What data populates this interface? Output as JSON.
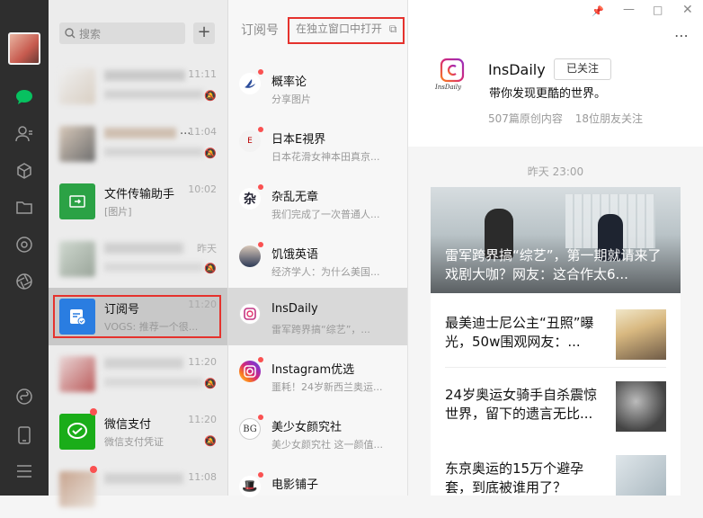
{
  "search": {
    "placeholder": "搜索"
  },
  "chats": [
    {
      "time": "11:11"
    },
    {
      "time": "11:04",
      "extra": "..."
    },
    {
      "name": "文件传输助手",
      "sub": "[图片]",
      "time": "10:02"
    },
    {
      "time": "昨天"
    },
    {
      "name": "订阅号",
      "sub": "VOGS: 推荐一个很...",
      "time": "11:20"
    },
    {
      "time": "11:20"
    },
    {
      "name": "微信支付",
      "sub": "微信支付凭证",
      "time": "11:20"
    },
    {
      "time": "11:08"
    }
  ],
  "subscription": {
    "title": "订阅号",
    "open_label": "在独立窗口中打开",
    "accounts": [
      {
        "name": "概率论",
        "sub": "分享图片"
      },
      {
        "name": "日本E視界",
        "sub": "日本花滑女神本田真京..."
      },
      {
        "name": "杂乱无章",
        "sub": "我们完成了一次普通人..."
      },
      {
        "name": "饥饿英语",
        "sub": "经济学人：为什么美国..."
      },
      {
        "name": "InsDaily",
        "sub": "雷军跨界搞“综艺”，..."
      },
      {
        "name": "Instagram优选",
        "sub": "噩耗！24岁新西兰奥运..."
      },
      {
        "name": "美少女颜究社",
        "sub": "美少女颜究社 这一颜值..."
      },
      {
        "name": "电影铺子",
        "sub": ""
      }
    ]
  },
  "profile": {
    "name": "InsDaily",
    "follow_label": "已关注",
    "description": "带你发现更酷的世界。",
    "articles": "507篇原创内容",
    "friends": "18位朋友关注",
    "logo_text": "InsDaily"
  },
  "feed": {
    "date": "昨天 23:00",
    "hero_title": "雷军跨界搞“综艺”，第一期就请来了戏剧大咖？网友：这合作太6...",
    "stories": [
      {
        "title": "最美迪士尼公主“丑照”曝光，50w围观网友：..."
      },
      {
        "title": "24岁奥运女骑手自杀震惊世界，留下的遗言无比..."
      },
      {
        "title": "东京奥运的15万个避孕套，到底被谁用了？"
      }
    ]
  },
  "colors": {
    "accent_green": "#07c160",
    "highlight_red": "#e5322d",
    "nav_bg": "#2e2e2e"
  }
}
